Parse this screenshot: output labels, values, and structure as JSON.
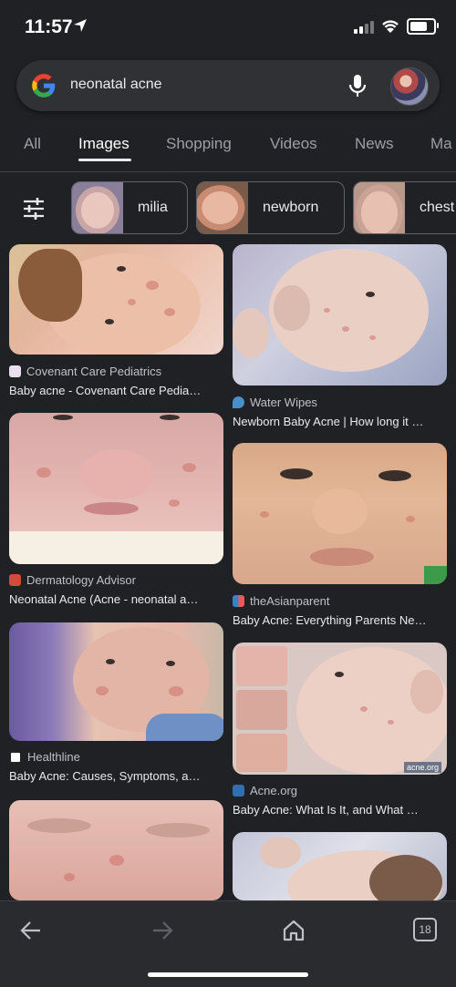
{
  "status": {
    "time": "11:57"
  },
  "search": {
    "query": "neonatal acne",
    "mic_icon": "mic-icon",
    "logo": "google-g-icon"
  },
  "tabs": [
    {
      "label": "All",
      "active": false
    },
    {
      "label": "Images",
      "active": true
    },
    {
      "label": "Shopping",
      "active": false
    },
    {
      "label": "Videos",
      "active": false
    },
    {
      "label": "News",
      "active": false
    },
    {
      "label": "Ma",
      "active": false
    }
  ],
  "chips": [
    {
      "label": "milia"
    },
    {
      "label": "newborn"
    },
    {
      "label": "chest"
    }
  ],
  "results_left": [
    {
      "source": "Covenant Care Pediatrics",
      "title": "Baby acne - Covenant Care Pedia…"
    },
    {
      "source": "Dermatology Advisor",
      "title": "Neonatal Acne (Acne - neonatal a…"
    },
    {
      "source": "Healthline",
      "title": "Baby Acne: Causes, Symptoms, a…"
    }
  ],
  "results_right": [
    {
      "source": "Water Wipes",
      "title": "Newborn Baby Acne | How long it …"
    },
    {
      "source": "theAsianparent",
      "title": "Baby Acne: Everything Parents Ne…"
    },
    {
      "source": "Acne.org",
      "title": "Baby Acne: What Is It, and What …",
      "watermark": "acne.org"
    }
  ],
  "bottom_nav": {
    "tab_count": "18"
  },
  "colors": {
    "background": "#202124",
    "search_bg": "#303134",
    "text": "#e8eaed",
    "muted": "#9aa0a6"
  }
}
